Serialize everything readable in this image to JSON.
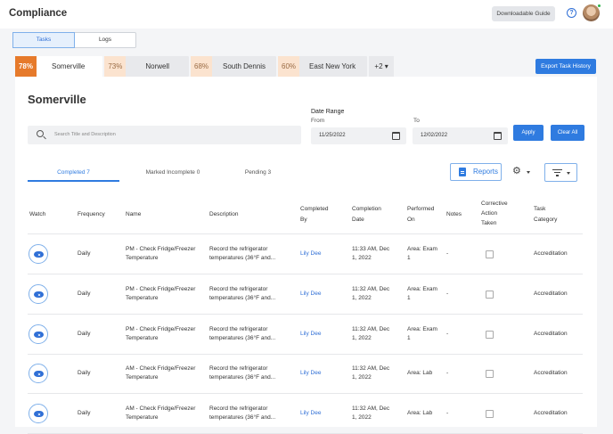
{
  "header": {
    "title": "Compliance",
    "guide_label": "Downloadable Guide",
    "help_icon": "?"
  },
  "view_toggle": {
    "tasks": "Tasks",
    "logs": "Logs"
  },
  "locations": [
    {
      "pct": "78%",
      "name": "Somerville"
    },
    {
      "pct": "73%",
      "name": "Norwell"
    },
    {
      "pct": "68%",
      "name": "South Dennis"
    },
    {
      "pct": "60%",
      "name": "East New York"
    }
  ],
  "more_locations": "+2 ▾",
  "export_label": "Export Task History",
  "panel": {
    "title": "Somerville",
    "search_placeholder": "Search Title and Description",
    "date_range_label": "Date Range",
    "from_label": "From",
    "to_label": "To",
    "from_value": "11/25/2022",
    "to_value": "12/02/2022",
    "apply_label": "Apply",
    "clear_label": "Clear All",
    "status_tabs": [
      "Completed 7",
      "Marked Incomplete 0",
      "Pending 3"
    ],
    "reports_label": "Reports",
    "gear_glyph": "⚙"
  },
  "table": {
    "headers": {
      "watch": "Watch",
      "frequency": "Frequency",
      "name": "Name",
      "description": "Description",
      "completed_by_1": "Completed",
      "completed_by_2": "By",
      "completion_date_1": "Completion",
      "completion_date_2": "Date",
      "performed_on_1": "Performed",
      "performed_on_2": "On",
      "notes": "Notes",
      "corrective_1": "Corrective",
      "corrective_2": "Action",
      "corrective_3": "Taken",
      "category_1": "Task",
      "category_2": "Category"
    },
    "rows": [
      {
        "frequency": "Daily",
        "name1": "PM - Check Fridge/Freezer",
        "name2": "Temperature",
        "desc1": "Record the refrigerator",
        "desc2": "temperatures (36°F and...",
        "by": "Lily Dee",
        "date1": "11:33 AM, Dec",
        "date2": "1, 2022",
        "perf1": "Area: Exam",
        "perf2": "1",
        "notes": "-",
        "category": "Accreditation"
      },
      {
        "frequency": "Daily",
        "name1": "PM - Check Fridge/Freezer",
        "name2": "Temperature",
        "desc1": "Record the refrigerator",
        "desc2": "temperatures (36°F and...",
        "by": "Lily Dee",
        "date1": "11:32 AM, Dec",
        "date2": "1, 2022",
        "perf1": "Area: Exam",
        "perf2": "1",
        "notes": "-",
        "category": "Accreditation"
      },
      {
        "frequency": "Daily",
        "name1": "PM - Check Fridge/Freezer",
        "name2": "Temperature",
        "desc1": "Record the refrigerator",
        "desc2": "temperatures (36°F and...",
        "by": "Lily Dee",
        "date1": "11:32 AM, Dec",
        "date2": "1, 2022",
        "perf1": "Area: Exam",
        "perf2": "1",
        "notes": "-",
        "category": "Accreditation"
      },
      {
        "frequency": "Daily",
        "name1": "AM - Check Fridge/Freezer",
        "name2": "Temperature",
        "desc1": "Record the refrigerator",
        "desc2": "temperatures (36°F and...",
        "by": "Lily Dee",
        "date1": "11:32 AM, Dec",
        "date2": "1, 2022",
        "perf1": "Area: Lab",
        "perf2": "",
        "notes": "-",
        "category": "Accreditation"
      },
      {
        "frequency": "Daily",
        "name1": "AM - Check Fridge/Freezer",
        "name2": "Temperature",
        "desc1": "Record the refrigerator",
        "desc2": "temperatures (36°F and...",
        "by": "Lily Dee",
        "date1": "11:32 AM, Dec",
        "date2": "1, 2022",
        "perf1": "Area: Lab",
        "perf2": "",
        "notes": "-",
        "category": "Accreditation"
      }
    ]
  },
  "colors": {
    "accent": "#2f7be0",
    "active_pct": "#e67a2b",
    "inactive_pct": "#fbe3cf"
  }
}
